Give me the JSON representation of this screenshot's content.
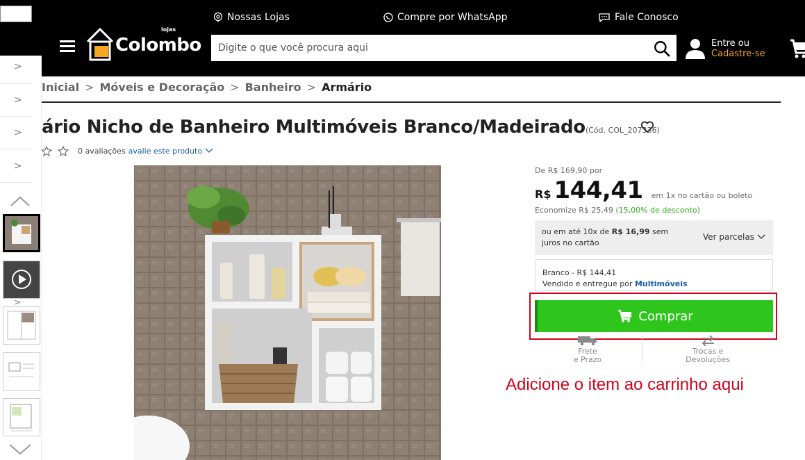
{
  "topbar": {
    "stores": "Nossas Lojas",
    "whatsapp": "Compre por WhatsApp",
    "contact": "Fale Conosco"
  },
  "header": {
    "logo_small": "lojas",
    "logo_text": "Colombo",
    "search_placeholder": "Digite o que você procura aqui",
    "login_line1": "Entre ou",
    "login_line2": "Cadastre-se"
  },
  "breadcrumb": {
    "items": [
      "Inicial",
      "Móveis e Decoração",
      "Banheiro",
      "Armário"
    ],
    "sep": ">"
  },
  "product": {
    "title": "ário Nicho de Banheiro Multimóveis Branco/Madeirado",
    "code": "(Cód. COL_207336)",
    "rating_count": "0 avaliações",
    "rating_link": "avalie este produto"
  },
  "price": {
    "old": "De R$ 169,90 por",
    "currency": "R$",
    "value": "144,41",
    "condition": "em 1x no cartão ou boleto",
    "savings_prefix": "Economize R$ 25,49",
    "savings_pct": "(15,00% de desconto)"
  },
  "installments": {
    "text_pre": "ou em até 10x de",
    "text_value": "R$ 16,99",
    "text_post": "sem juros no cartão",
    "more": "Ver parcelas"
  },
  "seller": {
    "variant": "Branco - R$ 144,41",
    "by": "Vendido e entregue por",
    "name": "Multimóveis"
  },
  "buy_button": "Comprar",
  "shipping": {
    "freight_1": "Frete",
    "freight_2": "e Prazo",
    "returns_1": "Trocas e",
    "returns_2": "Devoluções"
  },
  "annotation": "Adicione o item ao carrinho aqui",
  "colors": {
    "header_bg": "#000000",
    "accent_orange": "#f5a623",
    "buy_green": "#2ec51d",
    "highlight_red": "#d0021b",
    "link_blue": "#1a5fa8"
  }
}
